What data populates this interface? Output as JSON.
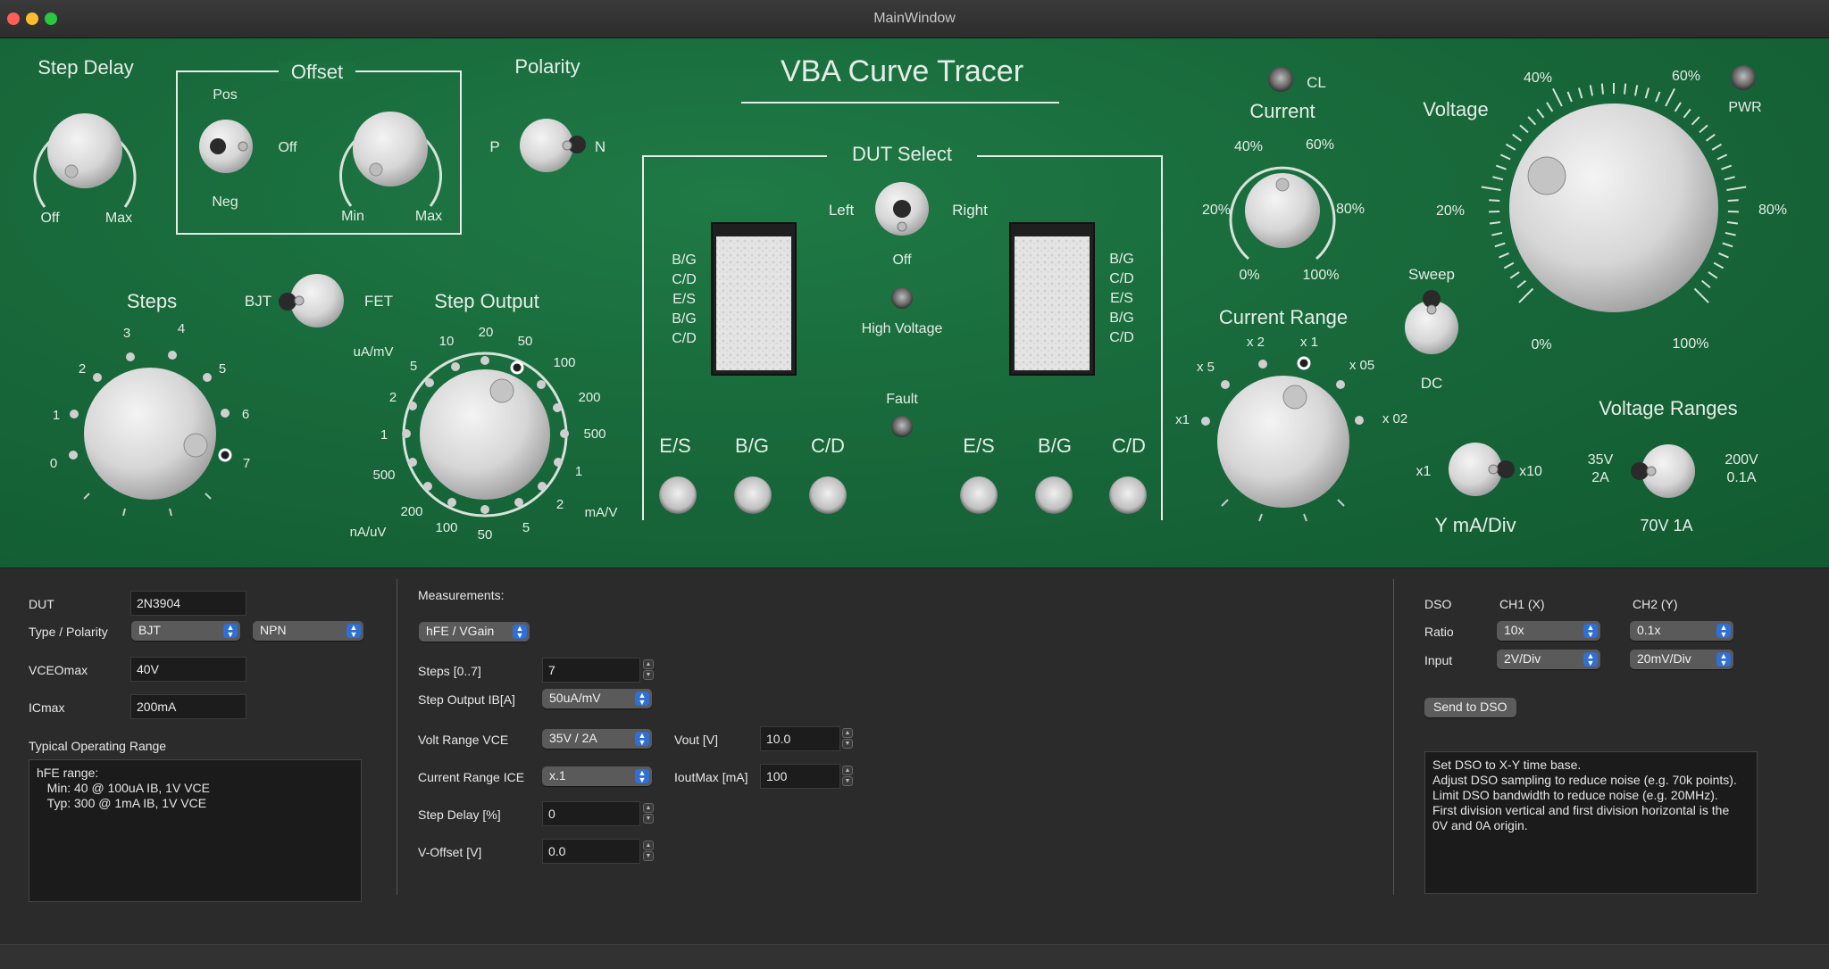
{
  "window": {
    "title": "MainWindow"
  },
  "panel": {
    "title": "VBA Curve Tracer",
    "step_delay": {
      "label": "Step Delay",
      "min": "Off",
      "max": "Max"
    },
    "offset": {
      "label": "Offset",
      "pos": "Pos",
      "neg": "Neg",
      "off": "Off",
      "min": "Min",
      "max": "Max"
    },
    "polarity": {
      "label": "Polarity",
      "p": "P",
      "n": "N"
    },
    "dut_select": {
      "label": "DUT Select",
      "left": "Left",
      "right": "Right",
      "off": "Off",
      "high_voltage": "High Voltage",
      "fault": "Fault",
      "pins": [
        "B/G",
        "C/D",
        "E/S",
        "B/G",
        "C/D"
      ],
      "terminals": [
        "E/S",
        "B/G",
        "C/D"
      ]
    },
    "bjt_fet": {
      "bjt": "BJT",
      "fet": "FET"
    },
    "steps": {
      "label": "Steps",
      "marks": [
        "0",
        "1",
        "2",
        "3",
        "4",
        "5",
        "6",
        "7"
      ]
    },
    "step_output": {
      "label": "Step Output",
      "unit_top": "uA/mV",
      "unit_bottom": "nA/uV",
      "unit_right": "mA/V",
      "marks": [
        "10",
        "20",
        "50",
        "100",
        "200",
        "500",
        "1",
        "2",
        "5",
        "50",
        "100",
        "200",
        "500",
        "1",
        "2",
        "5"
      ]
    },
    "current": {
      "label": "Current",
      "cl": "CL",
      "marks": [
        "0%",
        "20%",
        "40%",
        "60%",
        "80%",
        "100%"
      ]
    },
    "current_range": {
      "label": "Current Range",
      "marks": [
        "x1",
        "x 5",
        "x 2",
        "x 1",
        "x 05",
        "x 02"
      ]
    },
    "sweep": {
      "label": "Sweep",
      "dc": "DC"
    },
    "voltage": {
      "label": "Voltage",
      "pwr": "PWR",
      "marks": [
        "0%",
        "20%",
        "40%",
        "60%",
        "80%",
        "100%"
      ]
    },
    "voltage_ranges": {
      "label": "Voltage Ranges",
      "left_top": "35V",
      "left_bottom": "2A",
      "right_top": "200V",
      "right_bottom": "0.1A",
      "bottom": "70V 1A"
    },
    "y_div": {
      "label": "Y mA/Div",
      "x1": "x1",
      "x10": "x10"
    }
  },
  "form": {
    "dut_label": "DUT",
    "dut_value": "2N3904",
    "type_label": "Type / Polarity",
    "type_value": "BJT",
    "polarity_value": "NPN",
    "vceo_label": "VCEOmax",
    "vceo_value": "40V",
    "icmax_label": "ICmax",
    "icmax_value": "200mA",
    "typical_label": "Typical Operating Range",
    "typical_text": "hFE range:\n   Min: 40 @ 100uA IB, 1V VCE\n   Typ: 300 @ 1mA IB, 1V VCE"
  },
  "measurements": {
    "label": "Measurements:",
    "mode": "hFE / VGain",
    "steps_label": "Steps [0..7]",
    "steps_value": "7",
    "step_output_label": "Step Output IB[A]",
    "step_output_value": "50uA/mV",
    "volt_range_label": "Volt Range VCE",
    "volt_range_value": "35V / 2A",
    "vout_label": "Vout [V]",
    "vout_value": "10.0",
    "current_range_label": "Current Range ICE",
    "current_range_value": "x.1",
    "ioutmax_label": "IoutMax [mA]",
    "ioutmax_value": "100",
    "step_delay_label": "Step Delay [%]",
    "step_delay_value": "0",
    "voffset_label": "V-Offset [V]",
    "voffset_value": "0.0"
  },
  "dso": {
    "label": "DSO",
    "ch1": "CH1 (X)",
    "ch2": "CH2 (Y)",
    "ratio_label": "Ratio",
    "ratio_ch1": "10x",
    "ratio_ch2": "0.1x",
    "input_label": "Input",
    "input_ch1": "2V/Div",
    "input_ch2": "20mV/Div",
    "send_button": "Send to DSO",
    "notes": "Set DSO to X-Y time base.\nAdjust DSO sampling to reduce noise (e.g. 70k points).\nLimit DSO bandwidth to reduce noise (e.g. 20MHz).\nFirst division vertical and first division horizontal is the\n0V and 0A origin."
  }
}
